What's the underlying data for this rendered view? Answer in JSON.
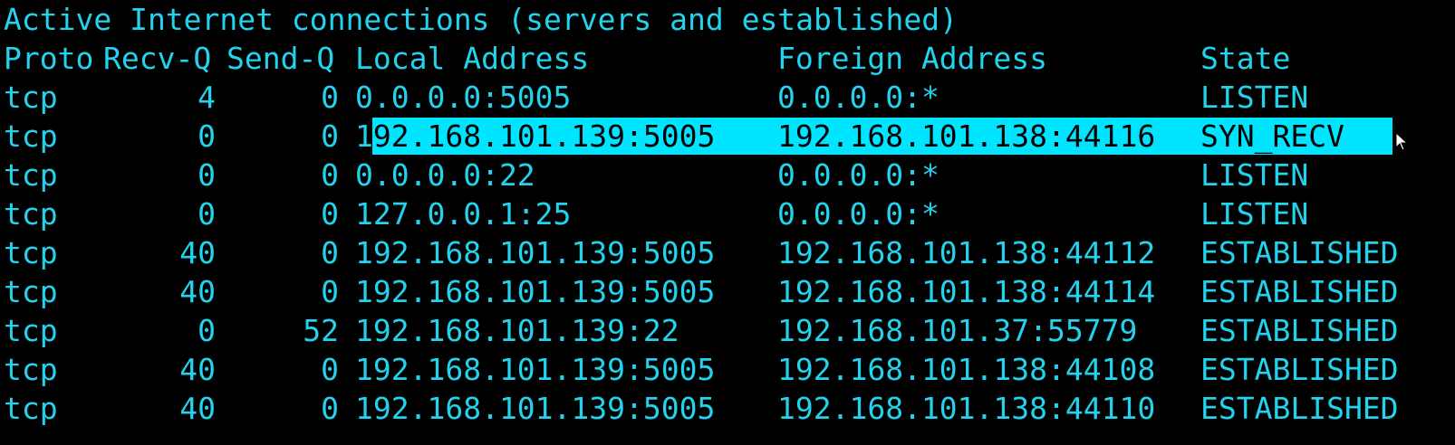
{
  "title": "Active Internet connections (servers and established)",
  "headers": {
    "proto": "Proto",
    "recv_q": "Recv-Q",
    "send_q": "Send-Q",
    "local": "Local Address",
    "foreign": "Foreign Address",
    "state": "State"
  },
  "rows": [
    {
      "proto": "tcp",
      "recv_q": "4",
      "send_q": "0",
      "local": "0.0.0.0:5005",
      "foreign": "0.0.0.0:*",
      "state": "LISTEN"
    },
    {
      "proto": "tcp",
      "recv_q": "0",
      "send_q": "0",
      "local": "192.168.101.139:5005",
      "local_prefix": "1",
      "local_selected": "92.168.101.139:5005",
      "foreign": "192.168.101.138:44116",
      "state": "SYN_RECV",
      "selected": true
    },
    {
      "proto": "tcp",
      "recv_q": "0",
      "send_q": "0",
      "local": "0.0.0.0:22",
      "foreign": "0.0.0.0:*",
      "state": "LISTEN"
    },
    {
      "proto": "tcp",
      "recv_q": "0",
      "send_q": "0",
      "local": "127.0.0.1:25",
      "foreign": "0.0.0.0:*",
      "state": "LISTEN"
    },
    {
      "proto": "tcp",
      "recv_q": "40",
      "send_q": "0",
      "local": "192.168.101.139:5005",
      "foreign": "192.168.101.138:44112",
      "state": "ESTABLISHED"
    },
    {
      "proto": "tcp",
      "recv_q": "40",
      "send_q": "0",
      "local": "192.168.101.139:5005",
      "foreign": "192.168.101.138:44114",
      "state": "ESTABLISHED"
    },
    {
      "proto": "tcp",
      "recv_q": "0",
      "send_q": "52",
      "local": "192.168.101.139:22",
      "foreign": "192.168.101.37:55779",
      "state": "ESTABLISHED"
    },
    {
      "proto": "tcp",
      "recv_q": "40",
      "send_q": "0",
      "local": "192.168.101.139:5005",
      "foreign": "192.168.101.138:44108",
      "state": "ESTABLISHED"
    },
    {
      "proto": "tcp",
      "recv_q": "40",
      "send_q": "0",
      "local": "192.168.101.139:5005",
      "foreign": "192.168.101.138:44110",
      "state": "ESTABLISHED"
    }
  ],
  "colors": {
    "background": "#000000",
    "text": "#22d3ee",
    "selection": "#00e5ff",
    "selection_text": "#000000"
  },
  "cursor_icon": "mouse-pointer-icon"
}
